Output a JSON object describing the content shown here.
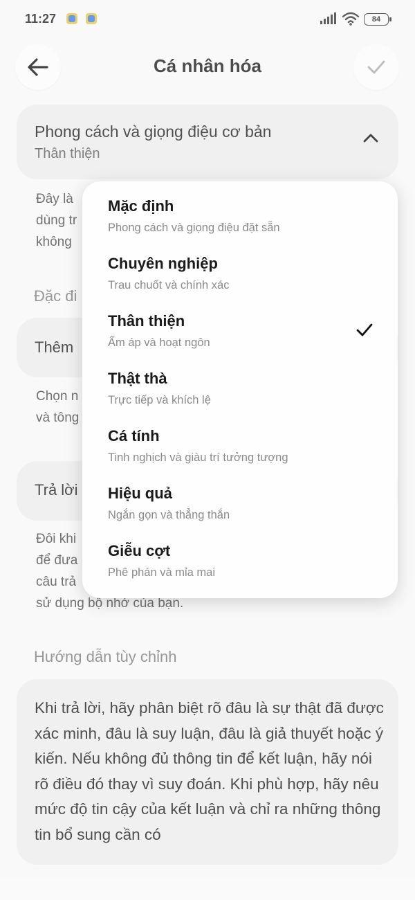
{
  "status_bar": {
    "time": "11:27",
    "battery": "84"
  },
  "header": {
    "title": "Cá nhân hóa"
  },
  "style_section": {
    "title": "Phong cách và giọng điệu cơ bản",
    "value": "Thân thiện"
  },
  "background": {
    "style_desc_lines": [
      "Đây là",
      "dùng tr",
      "không"
    ],
    "characteristics_label": "Đặc đi",
    "add_row_label": "Thêm",
    "add_desc_lines": [
      "Chọn n",
      "và tông"
    ],
    "reply_row_label": "Trả lời",
    "reply_desc_lines": [
      "Đôi khi",
      "để đưa",
      "câu trả",
      "sử dụng bộ nhớ của bạn."
    ]
  },
  "custom_instructions": {
    "label": "Hướng dẫn tùy chỉnh",
    "text": "Khi trả lời, hãy phân biệt rõ đâu là sự thật đã được xác minh, đâu là suy luận, đâu là giả thuyết hoặc ý kiến. Nếu không đủ thông tin để kết luận, hãy nói rõ điều đó thay vì suy đoán. Khi phù hợp, hãy nêu mức độ tin cậy của kết luận và chỉ ra những thông tin bổ sung cần có"
  },
  "menu": {
    "selected_index": 2,
    "items": [
      {
        "title": "Mặc định",
        "subtitle": "Phong cách và giọng điệu đặt sẵn"
      },
      {
        "title": "Chuyên nghiệp",
        "subtitle": "Trau chuốt và chính xác"
      },
      {
        "title": "Thân thiện",
        "subtitle": "Ấm áp và hoạt ngôn"
      },
      {
        "title": "Thật thà",
        "subtitle": "Trực tiếp và khích lệ"
      },
      {
        "title": "Cá tính",
        "subtitle": "Tinh nghịch và giàu trí tưởng tượng"
      },
      {
        "title": "Hiệu quả",
        "subtitle": "Ngắn gọn và thẳng thắn"
      },
      {
        "title": "Giễu cợt",
        "subtitle": "Phê phán và mỉa mai"
      }
    ]
  },
  "icons": {
    "back": "arrow-left-icon",
    "confirm": "checkmark-icon",
    "collapse": "chevron-up-icon",
    "selected": "checkmark-icon"
  }
}
